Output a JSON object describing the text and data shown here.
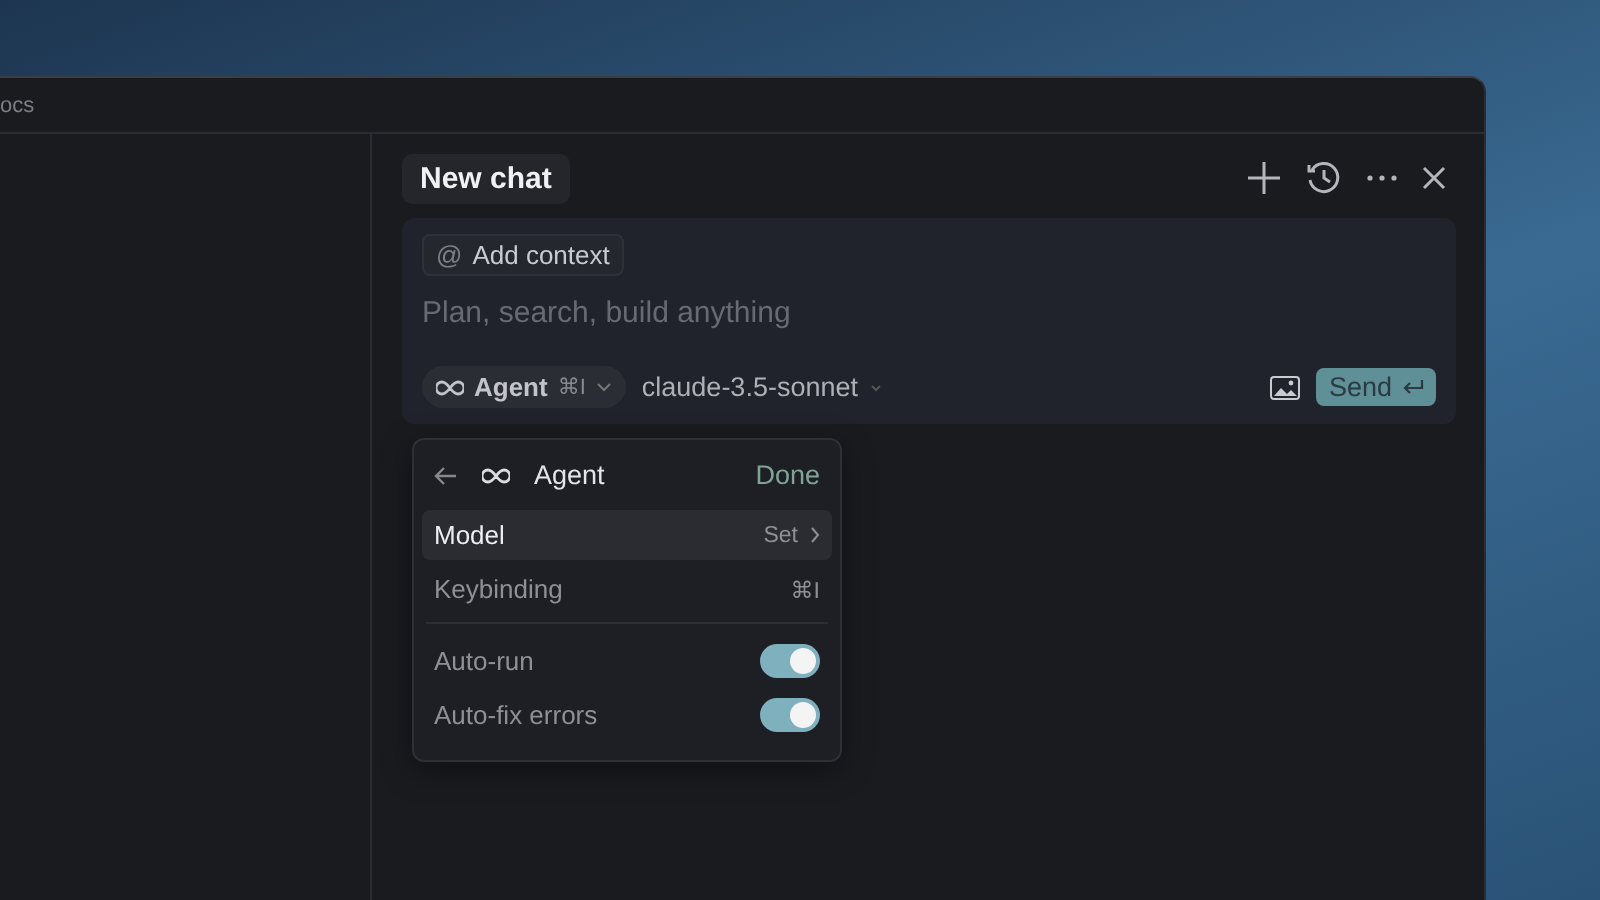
{
  "window": {
    "tab_title": "ocs"
  },
  "chat": {
    "title": "New chat",
    "composer": {
      "at_sign": "@",
      "context_button": "Add context",
      "placeholder": "Plan, search, build anything",
      "mode": {
        "label": "Agent",
        "shortcut": "⌘I"
      },
      "model": "claude-3.5-sonnet",
      "send": "Send"
    }
  },
  "agent_menu": {
    "title": "Agent",
    "done": "Done",
    "items": [
      {
        "kind": "link",
        "label": "Model",
        "value": "Set",
        "selected": true
      },
      {
        "kind": "shortcut",
        "label": "Keybinding",
        "value": "⌘I",
        "selected": false
      },
      {
        "kind": "toggle",
        "label": "Auto-run",
        "on": true,
        "selected": false
      },
      {
        "kind": "toggle",
        "label": "Auto-fix errors",
        "on": true,
        "selected": false
      }
    ]
  }
}
